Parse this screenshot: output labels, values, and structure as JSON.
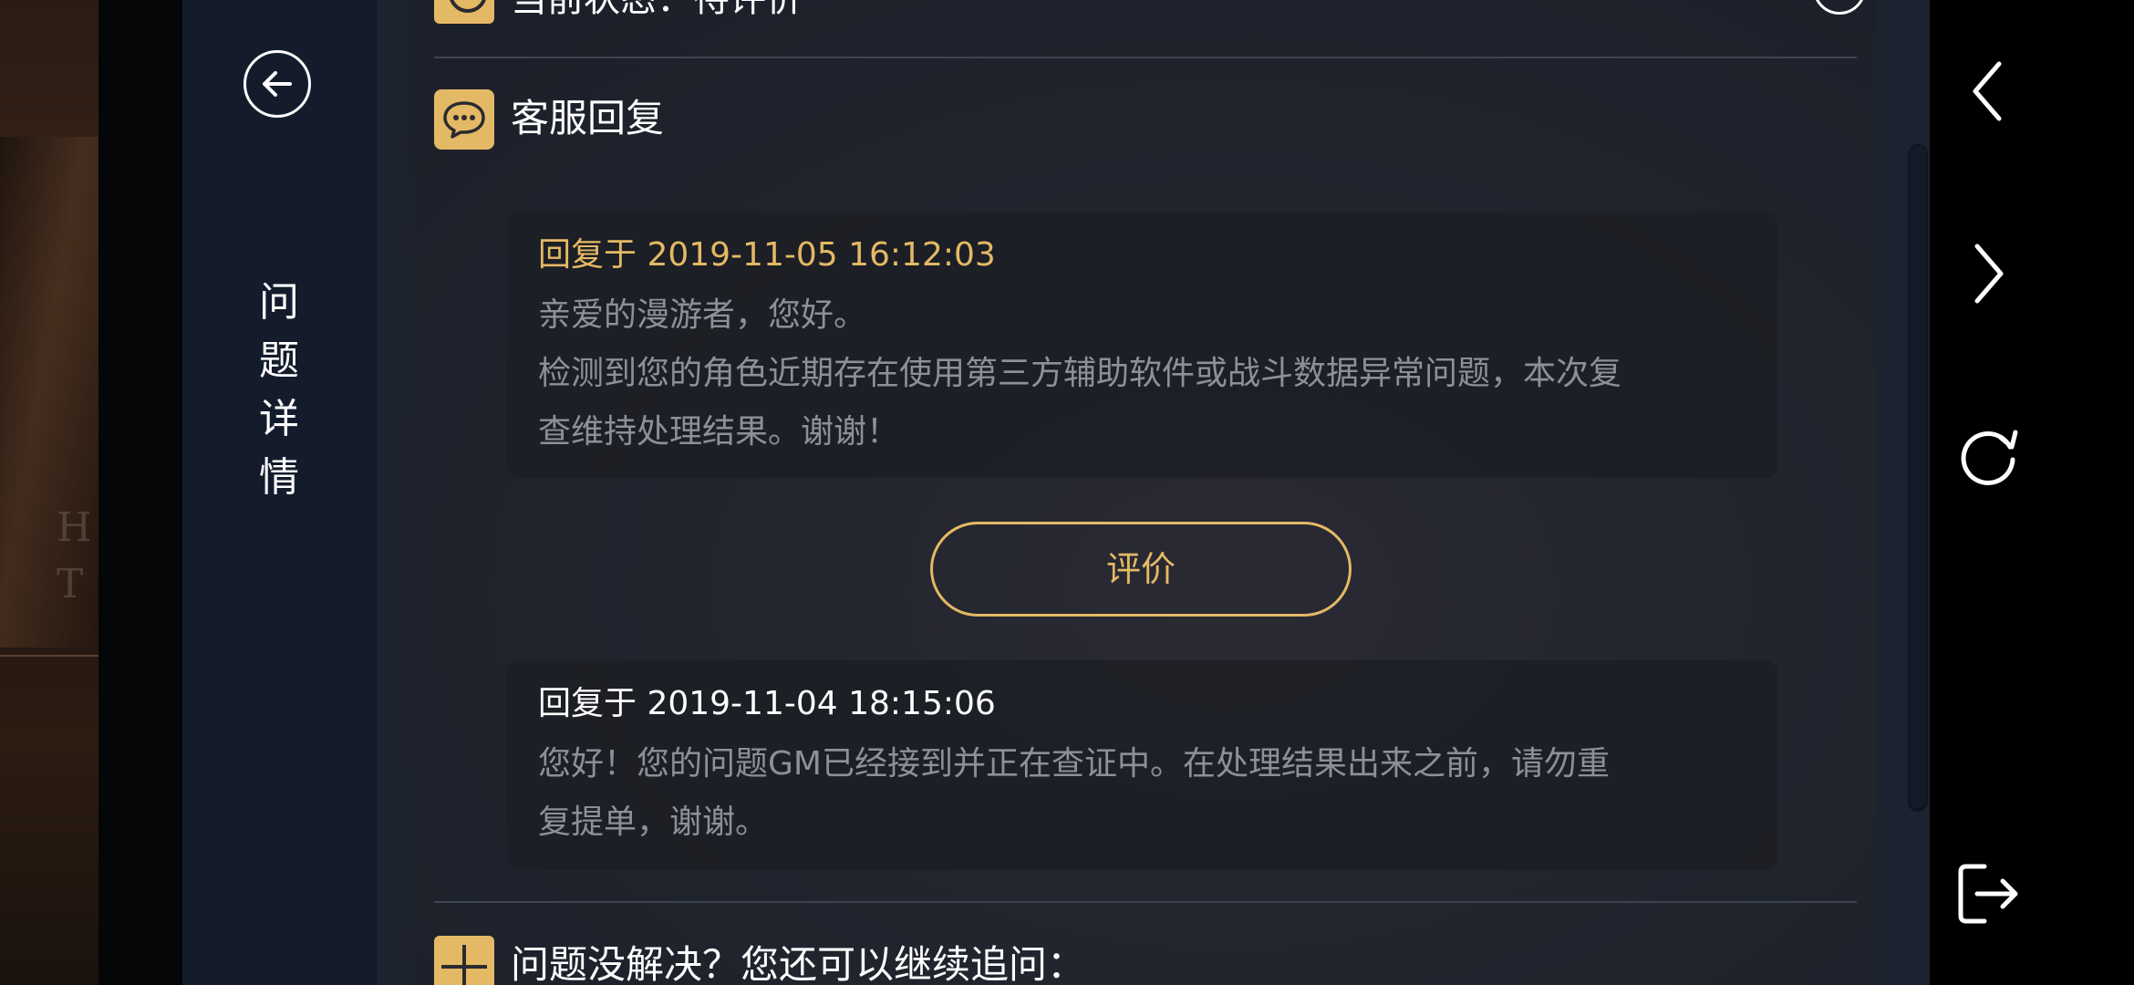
{
  "side_panel": {
    "title_chars": [
      "问",
      "题",
      "详",
      "情"
    ]
  },
  "status": {
    "text": "当前状态：待评价"
  },
  "customer_reply": {
    "title": "客服回复",
    "replies": [
      {
        "date": "回复于 2019-11-05 16:12:03",
        "lines": [
          "亲爱的漫游者，您好。",
          "检测到您的角色近期存在使用第三方辅助软件或战斗数据异常问题，本次复",
          "查维持处理结果。谢谢！"
        ]
      },
      {
        "date": "回复于 2019-11-04 18:15:06",
        "lines": [
          "您好！您的问题GM已经接到并正在查证中。在处理结果出来之前，请勿重",
          "复提单，谢谢。"
        ]
      }
    ],
    "rate_button": "评价"
  },
  "followup": {
    "text": "问题没解决？您还可以继续追问："
  },
  "colors": {
    "accent": "#e4b965",
    "panel": "#141c2c",
    "body_text": "#8d9099"
  },
  "icons": {
    "back": "back-arrow-icon",
    "chat": "chat-bubble-icon",
    "plus": "plus-icon",
    "nav_back": "chevron-left-icon",
    "nav_forward": "chevron-right-icon",
    "refresh": "refresh-icon",
    "exit": "exit-icon"
  }
}
